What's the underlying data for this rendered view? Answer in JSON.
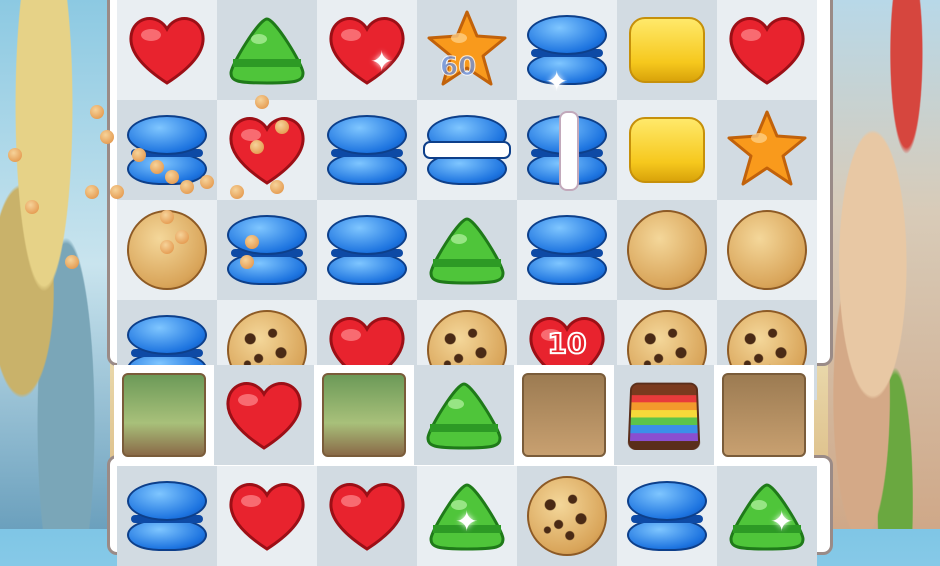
{
  "board": {
    "rows": [
      [
        "heart",
        "triangle",
        "heart",
        "star",
        "macaron",
        "square",
        "heart"
      ],
      [
        "macaron",
        "heart",
        "macaron",
        "macaron-striped-h",
        "macaron-striped-v",
        "square",
        "star"
      ],
      [
        "cookie-plain",
        "macaron",
        "macaron",
        "triangle",
        "macaron",
        "cookie-plain",
        "cookie-plain"
      ],
      [
        "macaron",
        "cookie-chips",
        "heart",
        "cookie-chips",
        "heart-numbered",
        "cookie-chips",
        "cookie-chips"
      ],
      [
        "blocker-green",
        "heart",
        "blocker-green",
        "triangle",
        "blocker",
        "rainbow-cake",
        "blocker"
      ],
      [
        "macaron",
        "heart",
        "heart",
        "triangle",
        "cookie-chips",
        "macaron",
        "triangle"
      ]
    ]
  },
  "heart_counter": "10",
  "score_popup": "60",
  "colors": {
    "heart": "#e8232e",
    "triangle": "#4fc53a",
    "star": "#f99a1c",
    "macaron": "#1d74e0",
    "square": "#f6c81d",
    "cookie": "#d9a55a",
    "board_border": "#9a8b87"
  }
}
